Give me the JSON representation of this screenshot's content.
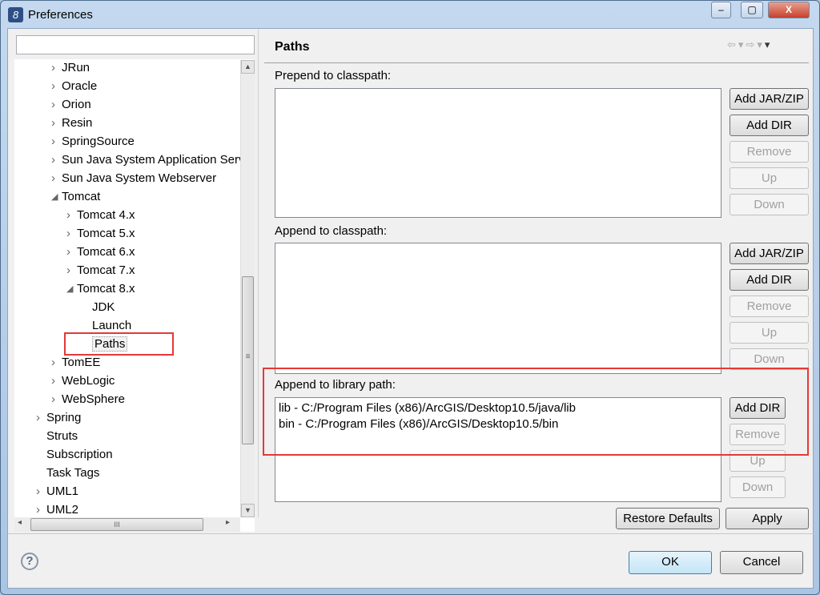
{
  "window": {
    "title": "Preferences",
    "minimize": "–",
    "maximize": "▢",
    "close": "X"
  },
  "filter": {
    "value": ""
  },
  "tree": {
    "items": [
      {
        "label": "JRun",
        "level": 2,
        "arrow": "collapsed"
      },
      {
        "label": "Oracle",
        "level": 2,
        "arrow": "collapsed"
      },
      {
        "label": "Orion",
        "level": 2,
        "arrow": "collapsed"
      },
      {
        "label": "Resin",
        "level": 2,
        "arrow": "collapsed"
      },
      {
        "label": "SpringSource",
        "level": 2,
        "arrow": "collapsed"
      },
      {
        "label": "Sun Java System Application Server",
        "level": 2,
        "arrow": "collapsed"
      },
      {
        "label": "Sun Java System Webserver",
        "level": 2,
        "arrow": "collapsed"
      },
      {
        "label": "Tomcat",
        "level": 2,
        "arrow": "expanded"
      },
      {
        "label": "Tomcat  4.x",
        "level": 3,
        "arrow": "collapsed"
      },
      {
        "label": "Tomcat  5.x",
        "level": 3,
        "arrow": "collapsed"
      },
      {
        "label": "Tomcat  6.x",
        "level": 3,
        "arrow": "collapsed"
      },
      {
        "label": "Tomcat  7.x",
        "level": 3,
        "arrow": "collapsed"
      },
      {
        "label": "Tomcat  8.x",
        "level": 3,
        "arrow": "expanded"
      },
      {
        "label": "JDK",
        "level": 4,
        "arrow": "none"
      },
      {
        "label": "Launch",
        "level": 4,
        "arrow": "none"
      },
      {
        "label": "Paths",
        "level": 4,
        "arrow": "none",
        "selected": true
      },
      {
        "label": "TomEE",
        "level": 2,
        "arrow": "collapsed"
      },
      {
        "label": "WebLogic",
        "level": 2,
        "arrow": "collapsed"
      },
      {
        "label": "WebSphere",
        "level": 2,
        "arrow": "collapsed"
      },
      {
        "label": "Spring",
        "level": 1,
        "arrow": "collapsed"
      },
      {
        "label": "Struts",
        "level": 1,
        "arrow": "none"
      },
      {
        "label": "Subscription",
        "level": 1,
        "arrow": "none"
      },
      {
        "label": "Task Tags",
        "level": 1,
        "arrow": "none"
      },
      {
        "label": "UML1",
        "level": 1,
        "arrow": "collapsed"
      },
      {
        "label": "UML2",
        "level": 1,
        "arrow": "collapsed"
      }
    ]
  },
  "page": {
    "title": "Paths"
  },
  "sections": [
    {
      "label": "Prepend to classpath:",
      "items": [],
      "buttons": [
        {
          "label": "Add JAR/ZIP",
          "enabled": true
        },
        {
          "label": "Add DIR",
          "enabled": true
        },
        {
          "label": "Remove",
          "enabled": false
        },
        {
          "label": "Up",
          "enabled": false
        },
        {
          "label": "Down",
          "enabled": false
        }
      ]
    },
    {
      "label": "Append to classpath:",
      "items": [],
      "buttons": [
        {
          "label": "Add JAR/ZIP",
          "enabled": true
        },
        {
          "label": "Add DIR",
          "enabled": true
        },
        {
          "label": "Remove",
          "enabled": false
        },
        {
          "label": "Up",
          "enabled": false
        },
        {
          "label": "Down",
          "enabled": false
        }
      ]
    },
    {
      "label": "Append to library path:",
      "items": [
        "lib - C:/Program Files (x86)/ArcGIS/Desktop10.5/java/lib",
        "bin - C:/Program Files (x86)/ArcGIS/Desktop10.5/bin"
      ],
      "buttons": [
        {
          "label": "Add DIR",
          "enabled": true
        },
        {
          "label": "Remove",
          "enabled": false
        },
        {
          "label": "Up",
          "enabled": false
        },
        {
          "label": "Down",
          "enabled": false
        }
      ]
    }
  ],
  "actions": {
    "restore_defaults": "Restore Defaults",
    "apply": "Apply",
    "ok": "OK",
    "cancel": "Cancel",
    "help": "?"
  },
  "colors": {
    "highlight": "#e53935"
  }
}
